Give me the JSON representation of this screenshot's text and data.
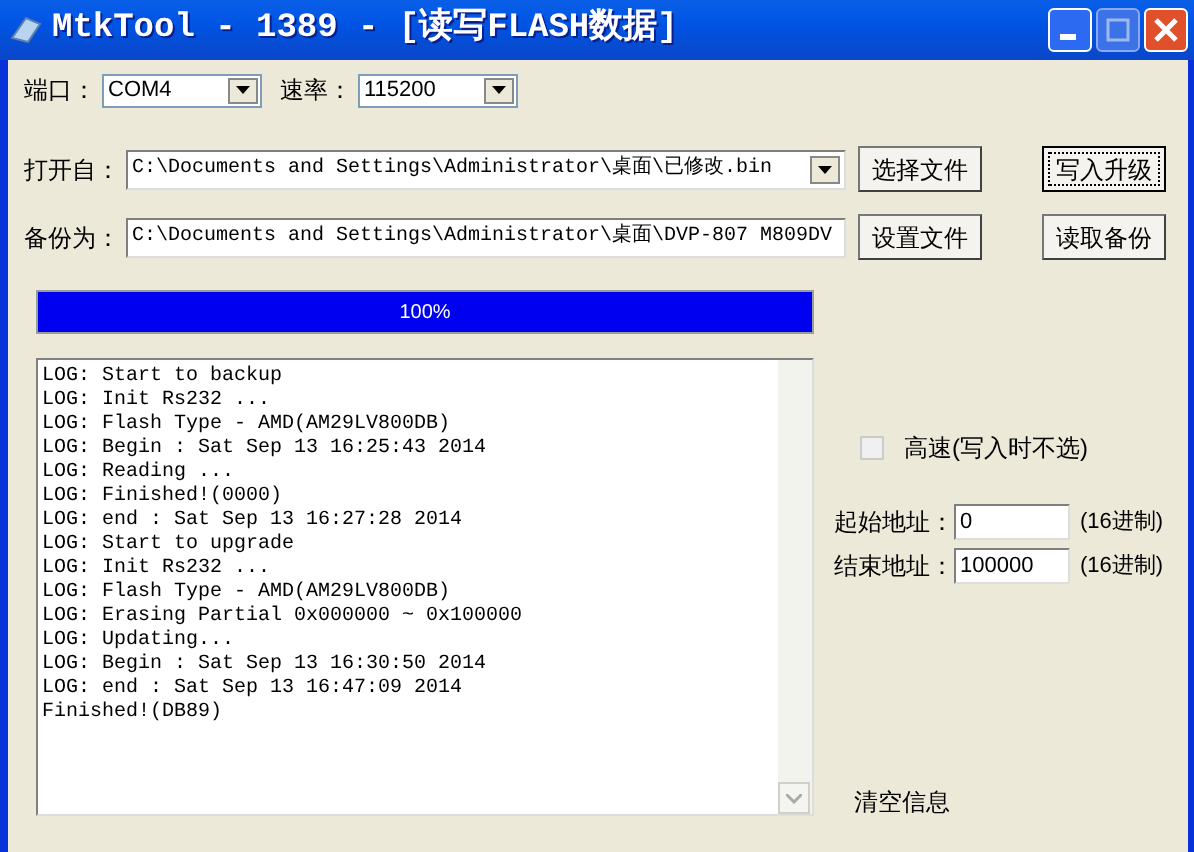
{
  "window": {
    "title": "MtkTool - 1389 - [读写FLASH数据]"
  },
  "port": {
    "label": "端口：",
    "value": "COM4"
  },
  "baud": {
    "label": "速率：",
    "value": "115200"
  },
  "open_file": {
    "label": "打开自：",
    "value": "C:\\Documents and Settings\\Administrator\\桌面\\已修改.bin",
    "button": "选择文件"
  },
  "backup_file": {
    "label": "备份为：",
    "value": "C:\\Documents and Settings\\Administrator\\桌面\\DVP-807 M809DV",
    "button": "设置文件"
  },
  "actions": [
    {
      "label": "写入升级",
      "focused": true
    },
    {
      "label": "读取备份",
      "focused": false
    }
  ],
  "progress": {
    "level": 1,
    "reading": "100%"
  },
  "log": {
    "lines": [
      "LOG: Start to backup",
      "LOG: Init Rs232 ...",
      "LOG: Flash Type - AMD(AM29LV800DB)",
      "LOG: Begin : Sat Sep 13 16:25:43 2014",
      "LOG: Reading ...",
      "LOG: Finished!(0000)",
      "LOG: end : Sat Sep 13 16:27:28 2014",
      "LOG: Start to upgrade",
      "LOG: Init Rs232 ...",
      "LOG: Flash Type - AMD(AM29LV800DB)",
      "LOG: Erasing Partial 0x000000 ~ 0x100000",
      "LOG: Updating...",
      "LOG: Begin : Sat Sep 13 16:30:50 2014",
      "LOG: end : Sat Sep 13 16:47:09 2014",
      "Finished!(DB89)"
    ]
  },
  "high_speed": {
    "label": "高速(写入时不选)",
    "checked": false
  },
  "start_address": {
    "label": "起始地址：",
    "value": "0",
    "unit": "(16进制)"
  },
  "end_address": {
    "label": "结束地址：",
    "value": "100000",
    "unit": "(16进制)"
  },
  "clear_log": {
    "label": "清空信息"
  }
}
